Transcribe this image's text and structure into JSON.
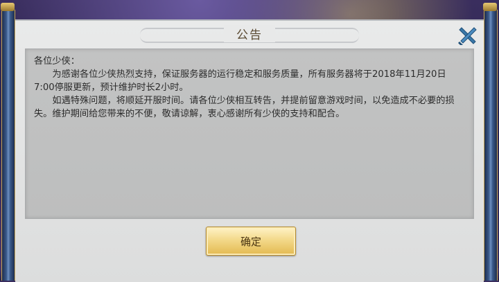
{
  "dialog": {
    "title": "公告",
    "close_icon": "close-x-icon",
    "greeting": "各位少侠：",
    "paragraphs": [
      "为感谢各位少侠热烈支持，保证服务器的运行稳定和服务质量，所有服务器将于2018年11月20日7:00停服更新，预计维护时长2小时。",
      "如遇特殊问题，将顺延开服时间。请各位少侠相互转告，并提前留意游戏时间，以免造成不必要的损失。维护期间给您带来的不便，敬请谅解，衷心感谢所有少侠的支持和配合。"
    ],
    "confirm_label": "确定"
  },
  "colors": {
    "accent_gold": "#e3b950",
    "panel": "#e9eaea",
    "close_icon": "#3a78a8"
  }
}
